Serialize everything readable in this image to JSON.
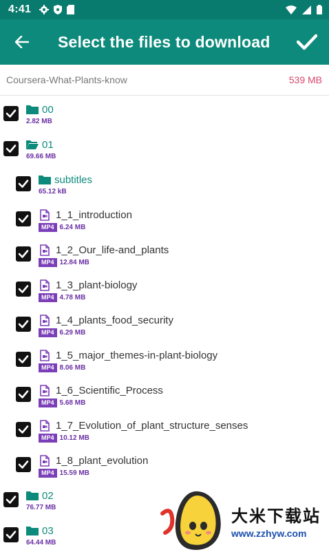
{
  "status_bar": {
    "time": "4:41",
    "left_icons": [
      "gear-icon",
      "shield-icon",
      "sdcard-icon"
    ],
    "right_icons": [
      "wifi-icon",
      "signal-icon",
      "battery-icon"
    ]
  },
  "app_bar": {
    "title": "Select the files to download",
    "back_icon": "arrow-left-icon",
    "confirm_icon": "check-icon",
    "color": "#0d8a7b"
  },
  "torrent": {
    "name": "Coursera-What-Plants-know",
    "total_size": "539 MB"
  },
  "items": [
    {
      "type": "folder",
      "name": "00",
      "size": "2.82 MB",
      "checked": true,
      "level": 0,
      "open": false
    },
    {
      "type": "folder",
      "name": "01",
      "size": "69.66 MB",
      "checked": true,
      "level": 0,
      "open": true
    },
    {
      "type": "folder",
      "name": "subtitles",
      "size": "65.12 kB",
      "checked": true,
      "level": 1,
      "open": false
    },
    {
      "type": "file",
      "name": "1_1_introduction",
      "badge": "MP4",
      "size": "6.24 MB",
      "checked": true,
      "level": 1
    },
    {
      "type": "file",
      "name": "1_2_Our_life-and_plants",
      "badge": "MP4",
      "size": "12.84 MB",
      "checked": true,
      "level": 1
    },
    {
      "type": "file",
      "name": "1_3_plant-biology",
      "badge": "MP4",
      "size": "4.78 MB",
      "checked": true,
      "level": 1
    },
    {
      "type": "file",
      "name": "1_4_plants_food_security",
      "badge": "MP4",
      "size": "6.29 MB",
      "checked": true,
      "level": 1
    },
    {
      "type": "file",
      "name": "1_5_major_themes-in-plant-biology",
      "badge": "MP4",
      "size": "8.06 MB",
      "checked": true,
      "level": 1
    },
    {
      "type": "file",
      "name": "1_6_Scientific_Process",
      "badge": "MP4",
      "size": "5.68 MB",
      "checked": true,
      "level": 1
    },
    {
      "type": "file",
      "name": "1_7_Evolution_of_plant_structure_senses",
      "badge": "MP4",
      "size": "10.12 MB",
      "checked": true,
      "level": 1
    },
    {
      "type": "file",
      "name": "1_8_plant_evolution",
      "badge": "MP4",
      "size": "15.59 MB",
      "checked": true,
      "level": 1
    },
    {
      "type": "folder",
      "name": "02",
      "size": "76.77 MB",
      "checked": true,
      "level": 0,
      "open": false
    },
    {
      "type": "folder",
      "name": "03",
      "size": "64.44 MB",
      "checked": true,
      "level": 0,
      "open": false
    }
  ],
  "watermark": {
    "title": "大米下载站",
    "url": "www.zzhyw.com"
  }
}
